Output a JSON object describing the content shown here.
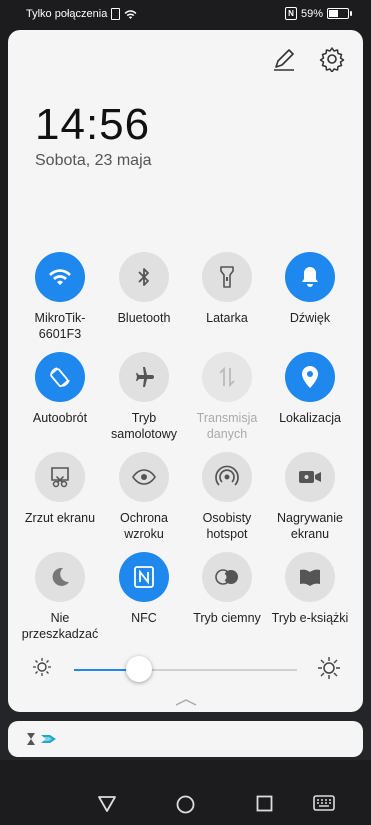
{
  "status_bar": {
    "carrier_text": "Tylko połączenia",
    "battery_percent": "59%",
    "battery_level": 0.59
  },
  "panel": {
    "time": "14:56",
    "date": "Sobota, 23 maja",
    "icons": [
      "edit-icon",
      "settings-icon"
    ]
  },
  "tiles": [
    {
      "label": "MikroTik-\n6601F3",
      "icon": "wifi-icon",
      "state": "on"
    },
    {
      "label": "Bluetooth",
      "icon": "bluetooth-icon",
      "state": "off"
    },
    {
      "label": "Latarka",
      "icon": "flashlight-icon",
      "state": "off"
    },
    {
      "label": "Dźwięk",
      "icon": "bell-icon",
      "state": "on"
    },
    {
      "label": "Autoobrót",
      "icon": "auto-rotate-icon",
      "state": "on"
    },
    {
      "label": "Tryb\nsamolotowy",
      "icon": "airplane-icon",
      "state": "off"
    },
    {
      "label": "Transmisja\ndanych",
      "icon": "mobile-data-icon",
      "state": "disabled"
    },
    {
      "label": "Lokalizacja",
      "icon": "location-icon",
      "state": "on"
    },
    {
      "label": "Zrzut ekranu",
      "icon": "screenshot-icon",
      "state": "off"
    },
    {
      "label": "Ochrona\nwzroku",
      "icon": "eye-icon",
      "state": "off"
    },
    {
      "label": "Osobisty\nhotspot",
      "icon": "hotspot-icon",
      "state": "off"
    },
    {
      "label": "Nagrywanie\nekranu",
      "icon": "screen-record-icon",
      "state": "off"
    },
    {
      "label": "Nie\nprzeszkadzać",
      "icon": "moon-icon",
      "state": "off"
    },
    {
      "label": "NFC",
      "icon": "nfc-icon",
      "state": "on"
    },
    {
      "label": "Tryb ciemny",
      "icon": "dark-mode-icon",
      "state": "off"
    },
    {
      "label": "Tryb e-książki",
      "icon": "ebook-icon",
      "state": "off"
    }
  ],
  "brightness": {
    "level": 0.29
  },
  "notification": {
    "icons": [
      "hourglass-icon",
      "arrow-logo-icon"
    ]
  },
  "navbar": {
    "icons": [
      "back-icon",
      "home-icon",
      "recents-icon",
      "keyboard-icon"
    ]
  },
  "colors": {
    "accent": "#1e88ee",
    "panel": "#f5f5f5",
    "tile_off": "#e0e0e0"
  }
}
